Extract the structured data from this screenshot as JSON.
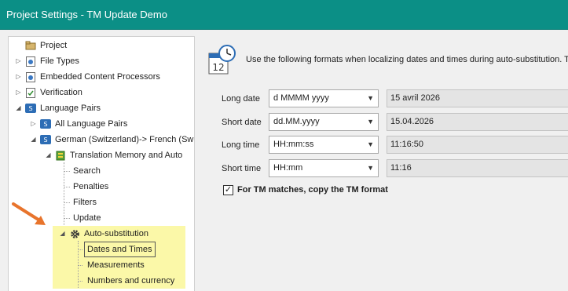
{
  "window": {
    "title": "Project Settings - TM Update Demo"
  },
  "tree": {
    "project": "Project",
    "file_types": "File Types",
    "embedded": "Embedded Content Processors",
    "verification": "Verification",
    "language_pairs": "Language Pairs",
    "all_language_pairs": "All Language Pairs",
    "german_french": "German (Switzerland)-> French (Sw",
    "tm_auto": "Translation Memory and Auto",
    "search": "Search",
    "penalties": "Penalties",
    "filters": "Filters",
    "update": "Update",
    "auto_sub": "Auto-substitution",
    "dates_times": "Dates and Times",
    "measurements": "Measurements",
    "numbers_currency": "Numbers and currency"
  },
  "panel": {
    "intro": "Use the following formats when localizing dates and times during auto-substitution. T",
    "rows": [
      {
        "label": "Long date",
        "format": "d MMMM yyyy",
        "preview": "15 avril 2026"
      },
      {
        "label": "Short date",
        "format": "dd.MM.yyyy",
        "preview": "15.04.2026"
      },
      {
        "label": "Long time",
        "format": "HH:mm:ss",
        "preview": "11:16:50"
      },
      {
        "label": "Short time",
        "format": "HH:mm",
        "preview": "11:16"
      }
    ],
    "copy_format": {
      "label": "For TM matches, copy the TM format",
      "checked": true
    }
  },
  "colors": {
    "titlebar": "#0b8f86",
    "highlight": "#fbf8a8",
    "arrow": "#e8742c"
  }
}
